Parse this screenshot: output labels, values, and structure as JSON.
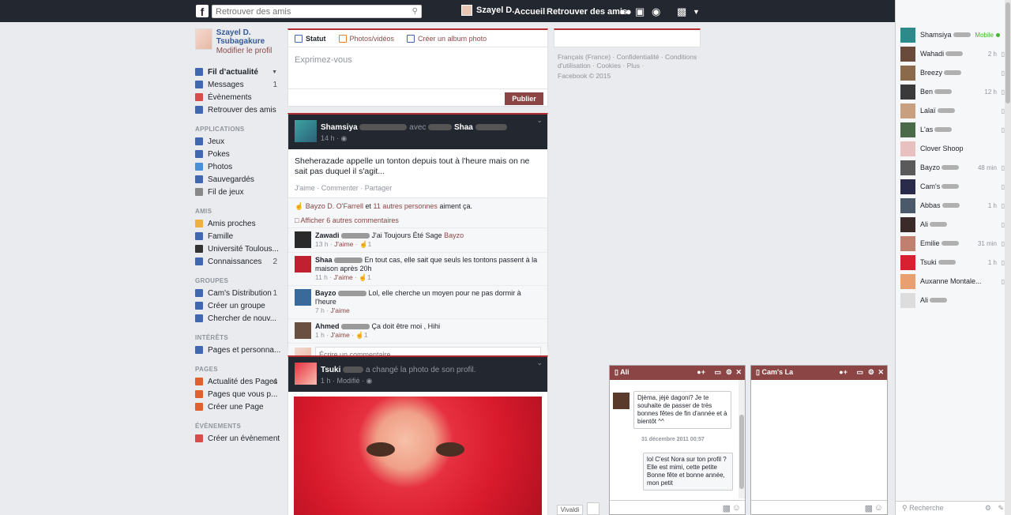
{
  "topbar": {
    "search_placeholder": "Retrouver des amis",
    "user_name": "Szayel D.",
    "home": "Accueil",
    "find_friends": "Retrouver des amis"
  },
  "profile": {
    "name": "Szayel D. Tsubagakure",
    "edit": "Modifier le profil"
  },
  "nav": {
    "favorites": [
      {
        "label": "Fil d’actualité",
        "count": "",
        "color": "#4267b2"
      },
      {
        "label": "Messages",
        "count": "1",
        "color": "#4267b2"
      },
      {
        "label": "Évènements",
        "count": "",
        "color": "#d84c4c"
      },
      {
        "label": "Retrouver des amis",
        "count": "",
        "color": "#4267b2"
      }
    ],
    "sections": {
      "applications": "APPLICATIONS",
      "amis": "AMIS",
      "groupes": "GROUPES",
      "interets": "INTÉRÊTS",
      "pages": "PAGES",
      "evenements": "ÉVÈNEMENTS"
    },
    "applications": [
      {
        "label": "Jeux",
        "color": "#4267b2"
      },
      {
        "label": "Pokes",
        "color": "#4267b2"
      },
      {
        "label": "Photos",
        "color": "#4a90d9"
      },
      {
        "label": "Sauvegardés",
        "color": "#4267b2"
      },
      {
        "label": "Fil de jeux",
        "color": "#888"
      }
    ],
    "amis": [
      {
        "label": "Amis proches",
        "count": "",
        "color": "#f0b040"
      },
      {
        "label": "Famille",
        "count": "",
        "color": "#4267b2"
      },
      {
        "label": "Université Toulous...",
        "count": "",
        "color": "#333"
      },
      {
        "label": "Connaissances",
        "count": "2",
        "color": "#4267b2"
      }
    ],
    "groupes": [
      {
        "label": "Cam's Distribution",
        "count": "1",
        "color": "#4267b2"
      },
      {
        "label": "Créer un groupe",
        "count": "",
        "color": "#4267b2"
      },
      {
        "label": "Chercher de nouv...",
        "count": "",
        "color": "#4267b2"
      }
    ],
    "interets": [
      {
        "label": "Pages et personna...",
        "count": "",
        "color": "#4267b2"
      }
    ],
    "pages": [
      {
        "label": "Actualité des Pages",
        "count": "4",
        "color": "#e06030"
      },
      {
        "label": "Pages que vous p...",
        "count": "",
        "color": "#e06030"
      },
      {
        "label": "Créer une Page",
        "count": "",
        "color": "#e06030"
      }
    ],
    "evenements": [
      {
        "label": "Créer un évènement",
        "count": "",
        "color": "#d84c4c"
      }
    ]
  },
  "composer": {
    "tab_status": "Statut",
    "tab_photos": "Photos/vidéos",
    "tab_album": "Créer un album photo",
    "placeholder": "Exprimez-vous",
    "publish": "Publier"
  },
  "post1": {
    "author": "Shamsiya",
    "with": "avec",
    "tagged": "Shaa",
    "time": "14 h",
    "text": "Sheherazade appelle un tonton depuis tout à l'heure mais on ne sait pas duquel il s'agit...",
    "actions": "J'aime · Commenter · Partager",
    "likes_name": "Bayzo D. O'Farrell",
    "likes_et": "et",
    "likes_others": "11 autres personnes",
    "likes_suffix": "aiment ça.",
    "more_comments": "Afficher 6 autres commentaires",
    "comments": [
      {
        "who": "Zawadi",
        "text": "J'ai Toujours Été Sage",
        "tag": "Bayzo",
        "time": "13 h",
        "like": "J'aime",
        "count": "1"
      },
      {
        "who": "Shaa",
        "text": "En tout cas, elle sait que seuls les tontons passent à la maison après 20h",
        "tag": "",
        "time": "11 h",
        "like": "J'aime",
        "count": "1"
      },
      {
        "who": "Bayzo",
        "text": "Lol, elle cherche un moyen pour ne pas dormir à l'heure",
        "tag": "",
        "time": "7 h",
        "like": "J'aime",
        "count": ""
      },
      {
        "who": "Ahmed",
        "text": "Ça doit être moi , Hihi",
        "tag": "",
        "time": "1 h",
        "like": "J'aime",
        "count": "1"
      }
    ],
    "write_placeholder": "Écrire un commentaire..."
  },
  "post2": {
    "author": "Tsuki",
    "action": "a changé la photo de son profil.",
    "time": "1 h",
    "modified": "Modifié"
  },
  "footer": {
    "links": "Français (France) · Confidentialité · Conditions d'utilisation · Cookies · Plus ·",
    "copyright": "Facebook © 2015"
  },
  "chat": {
    "contacts": [
      {
        "name": "Shamsiya",
        "status": "Mobile",
        "color": "#2d8a8a"
      },
      {
        "name": "Wahadi",
        "status": "2 h",
        "color": "#6a4a3a"
      },
      {
        "name": "Breezy",
        "status": "",
        "color": "#8a6a4a"
      },
      {
        "name": "Ben",
        "status": "12 h",
        "color": "#3a3a3a"
      },
      {
        "name": "Lalaï",
        "status": "",
        "color": "#c8a080"
      },
      {
        "name": "L'as",
        "status": "",
        "color": "#4a6a4a"
      },
      {
        "name": "Clover Shoop",
        "status": "",
        "color": "#e8c0c0"
      },
      {
        "name": "Bayzo",
        "status": "48 min",
        "color": "#5a5a5a"
      },
      {
        "name": "Cam's",
        "status": "",
        "color": "#2a2a4a"
      },
      {
        "name": "Abbas",
        "status": "1 h",
        "color": "#4a5a6a"
      },
      {
        "name": "Ali",
        "status": "",
        "color": "#3a2a2a"
      },
      {
        "name": "Emilie",
        "status": "31 min",
        "color": "#c08070"
      },
      {
        "name": "Tsuki",
        "status": "1 h",
        "color": "#d82030"
      },
      {
        "name": "Auxanne Montale...",
        "status": "",
        "color": "#e8a070"
      },
      {
        "name": "Ali",
        "status": "",
        "color": "#dddddd"
      }
    ],
    "search_placeholder": "Recherche",
    "window1": {
      "name": "Ali",
      "msg1": "Djèma, jèjè dagoni? Je te souhaite de passer de très bonnes fêtes de fin d'année et à bientôt ^^",
      "date": "31 décembre 2011 00:57",
      "msg2": "lol C'est Nora sur ton profil ? Elle est mimi, cette petite Bonne fête et bonne année, mon petit"
    },
    "window2": {
      "name": "Cam's La"
    },
    "vivaldi": "Vivaldi"
  }
}
